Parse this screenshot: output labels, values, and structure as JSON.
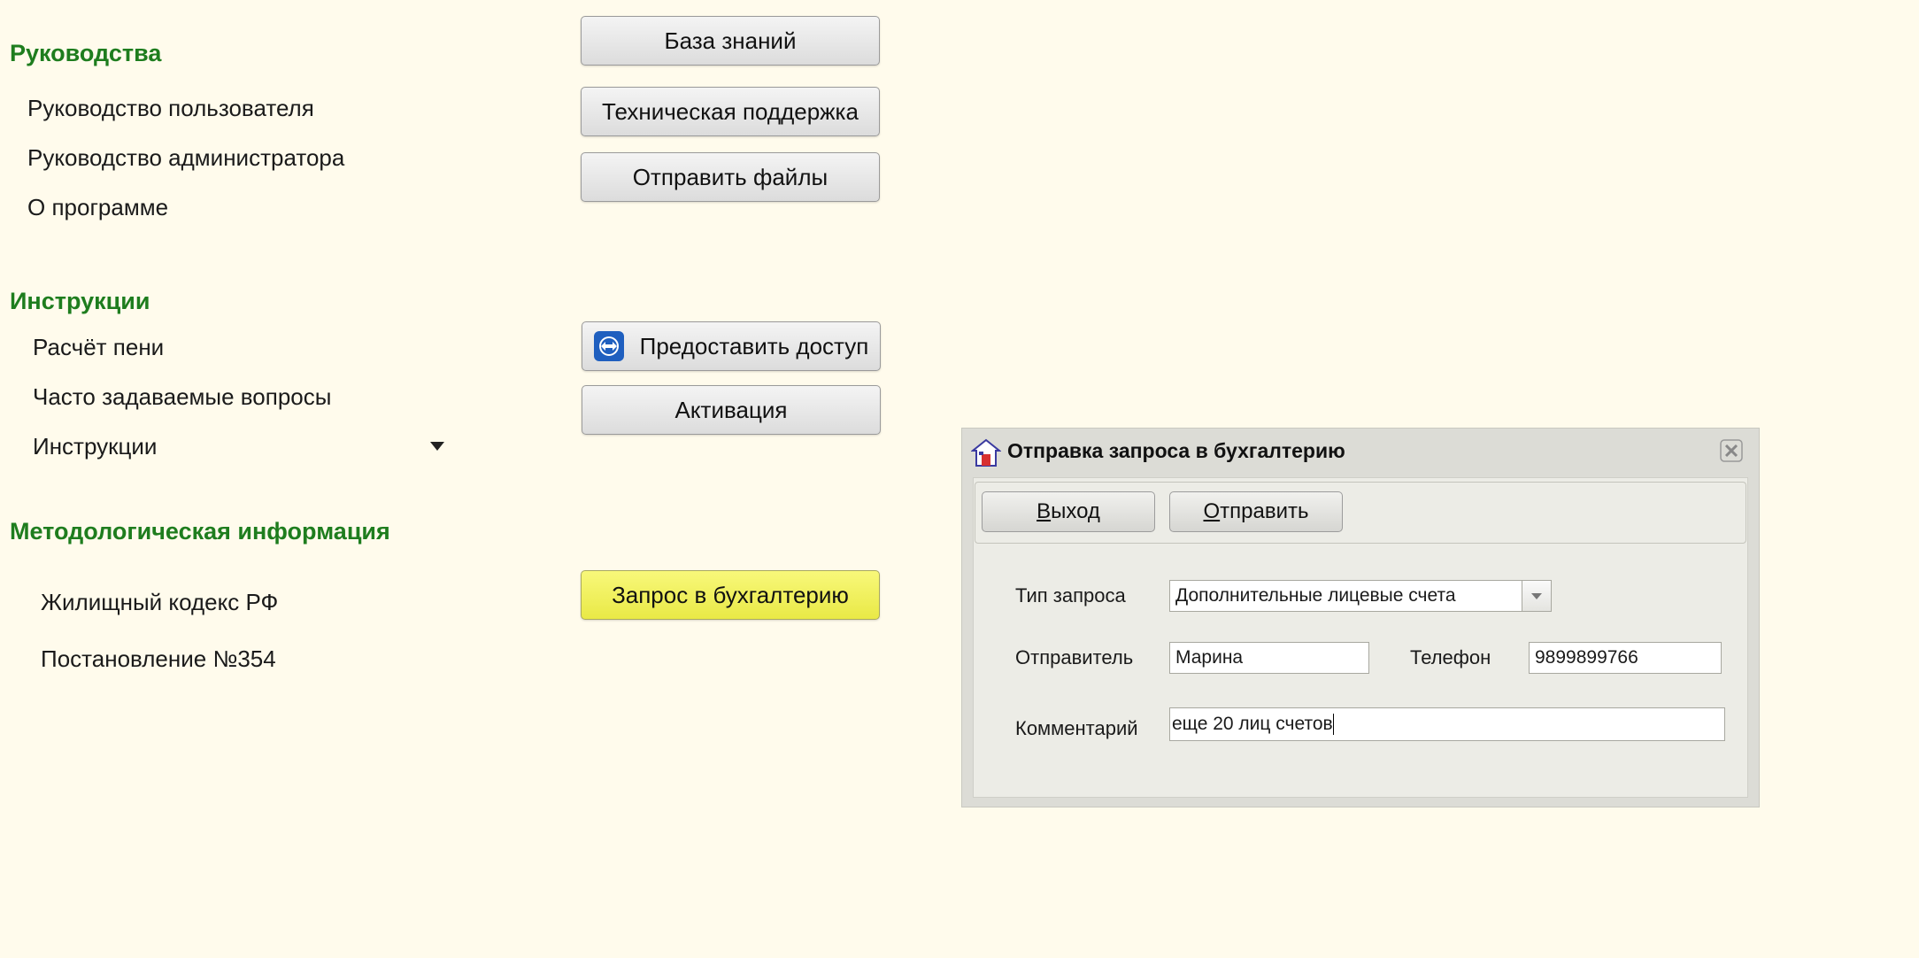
{
  "left": {
    "sections": [
      {
        "title": "Руководства",
        "items": [
          "Руководство пользователя",
          "Руководство администратора",
          "О программе"
        ]
      },
      {
        "title": "Инструкции",
        "items": [
          "Расчёт пени",
          "Часто задаваемые вопросы",
          "Инструкции"
        ]
      },
      {
        "title": "Методологическая информация",
        "items": [
          "Жилищный кодекс РФ",
          "Постановление №354"
        ]
      }
    ]
  },
  "buttons": {
    "knowledge_base": "База знаний",
    "tech_support": "Техническая поддержка",
    "send_files": "Отправить файлы",
    "grant_access": "Предоставить доступ",
    "activation": "Активация",
    "accounting_request": "Запрос в бухгалтерию"
  },
  "dialog": {
    "title": "Отправка запроса в бухгалтерию",
    "exit_first": "В",
    "exit_rest": "ыход",
    "send_first": "О",
    "send_rest": "тправить",
    "request_type_label": "Тип запроса",
    "request_type_value": "Дополнительные лицевые счета",
    "sender_label": "Отправитель",
    "sender_value": "Марина",
    "phone_label": "Телефон",
    "phone_value": "9899899766",
    "comment_label": "Комментарий",
    "comment_value": "еще 20 лиц счетов"
  },
  "colors": {
    "background": "#fffbec",
    "section_title": "#1e7d1e",
    "highlight_button": "#eeee55"
  }
}
